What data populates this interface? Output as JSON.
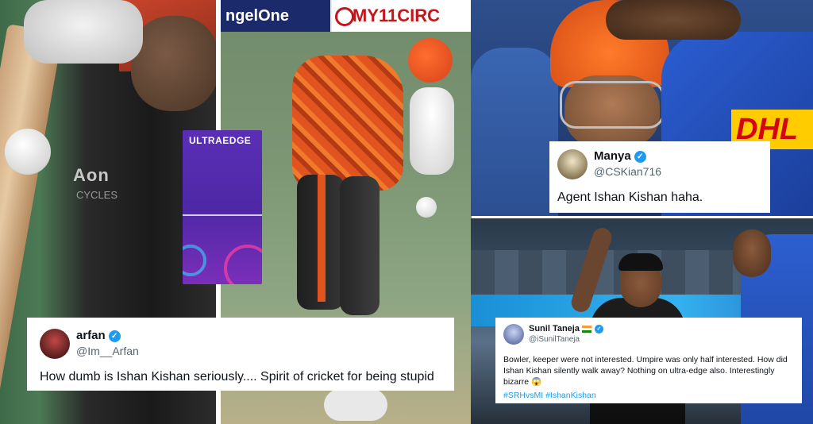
{
  "panel_left": {
    "shirt_logo": "Aon",
    "shirt_logo_sub": "CYCLES"
  },
  "panel_batsman": {
    "board_left": "ngelOne",
    "board_right": "MY11CIRC",
    "ultraedge_label": "ULTRAEDGE"
  },
  "panel_top_right": {
    "jersey_sponsor": "DHL"
  },
  "tweets": {
    "manya": {
      "name": "Manya",
      "handle": "@CSKian716",
      "text": "Agent Ishan Kishan haha."
    },
    "arfan": {
      "name": "arfan",
      "handle": "@Im__Arfan",
      "text": "How dumb is Ishan Kishan seriously.... Spirit of cricket for being stupid"
    },
    "sunil": {
      "name": "Sunil Taneja",
      "handle": "@iSunilTaneja",
      "text": "Bowler, keeper were not interested. Umpire was only half interested. How did Ishan Kishan silently walk away? Nothing on ultra-edge also. Interestingly bizarre 😱",
      "hashtags": "#SRHvsMI #IshanKishan"
    }
  },
  "colors": {
    "twitter_blue": "#1d9bf0",
    "srh_orange": "#e2541f",
    "mi_blue": "#2b5ed2"
  }
}
